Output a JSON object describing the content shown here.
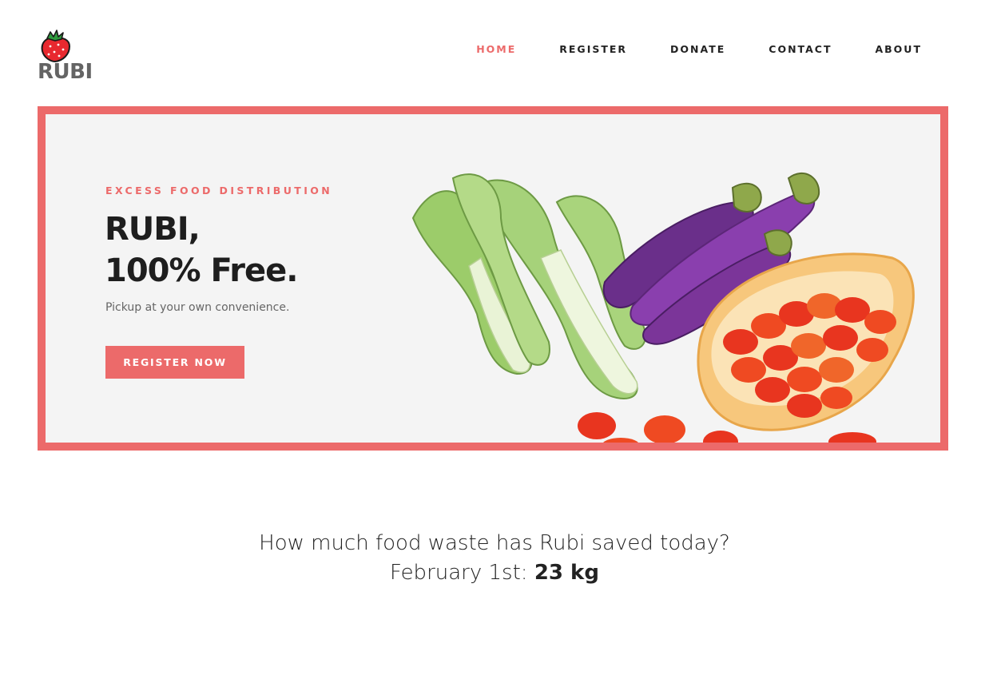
{
  "brand": {
    "name": "RUBI",
    "logo_icon": "strawberry-icon",
    "colors": {
      "accent": "#ec6a6a",
      "logo_text": "#646464",
      "hero_bg": "#f4f4f4"
    }
  },
  "nav": {
    "items": [
      {
        "label": "HOME",
        "active": true
      },
      {
        "label": "REGISTER",
        "active": false
      },
      {
        "label": "DONATE",
        "active": false
      },
      {
        "label": "CONTACT",
        "active": false
      },
      {
        "label": "ABOUT",
        "active": false
      }
    ]
  },
  "hero": {
    "eyebrow": "EXCESS FOOD DISTRIBUTION",
    "title_line1": "RUBI,",
    "title_line2": "100% Free.",
    "subtitle": "Pickup at your own convenience.",
    "cta_label": "REGISTER NOW",
    "image": "vegetables-photo"
  },
  "stats": {
    "question": "How much food waste has Rubi saved today?",
    "date_label": "February 1st:",
    "amount": "23 kg"
  }
}
